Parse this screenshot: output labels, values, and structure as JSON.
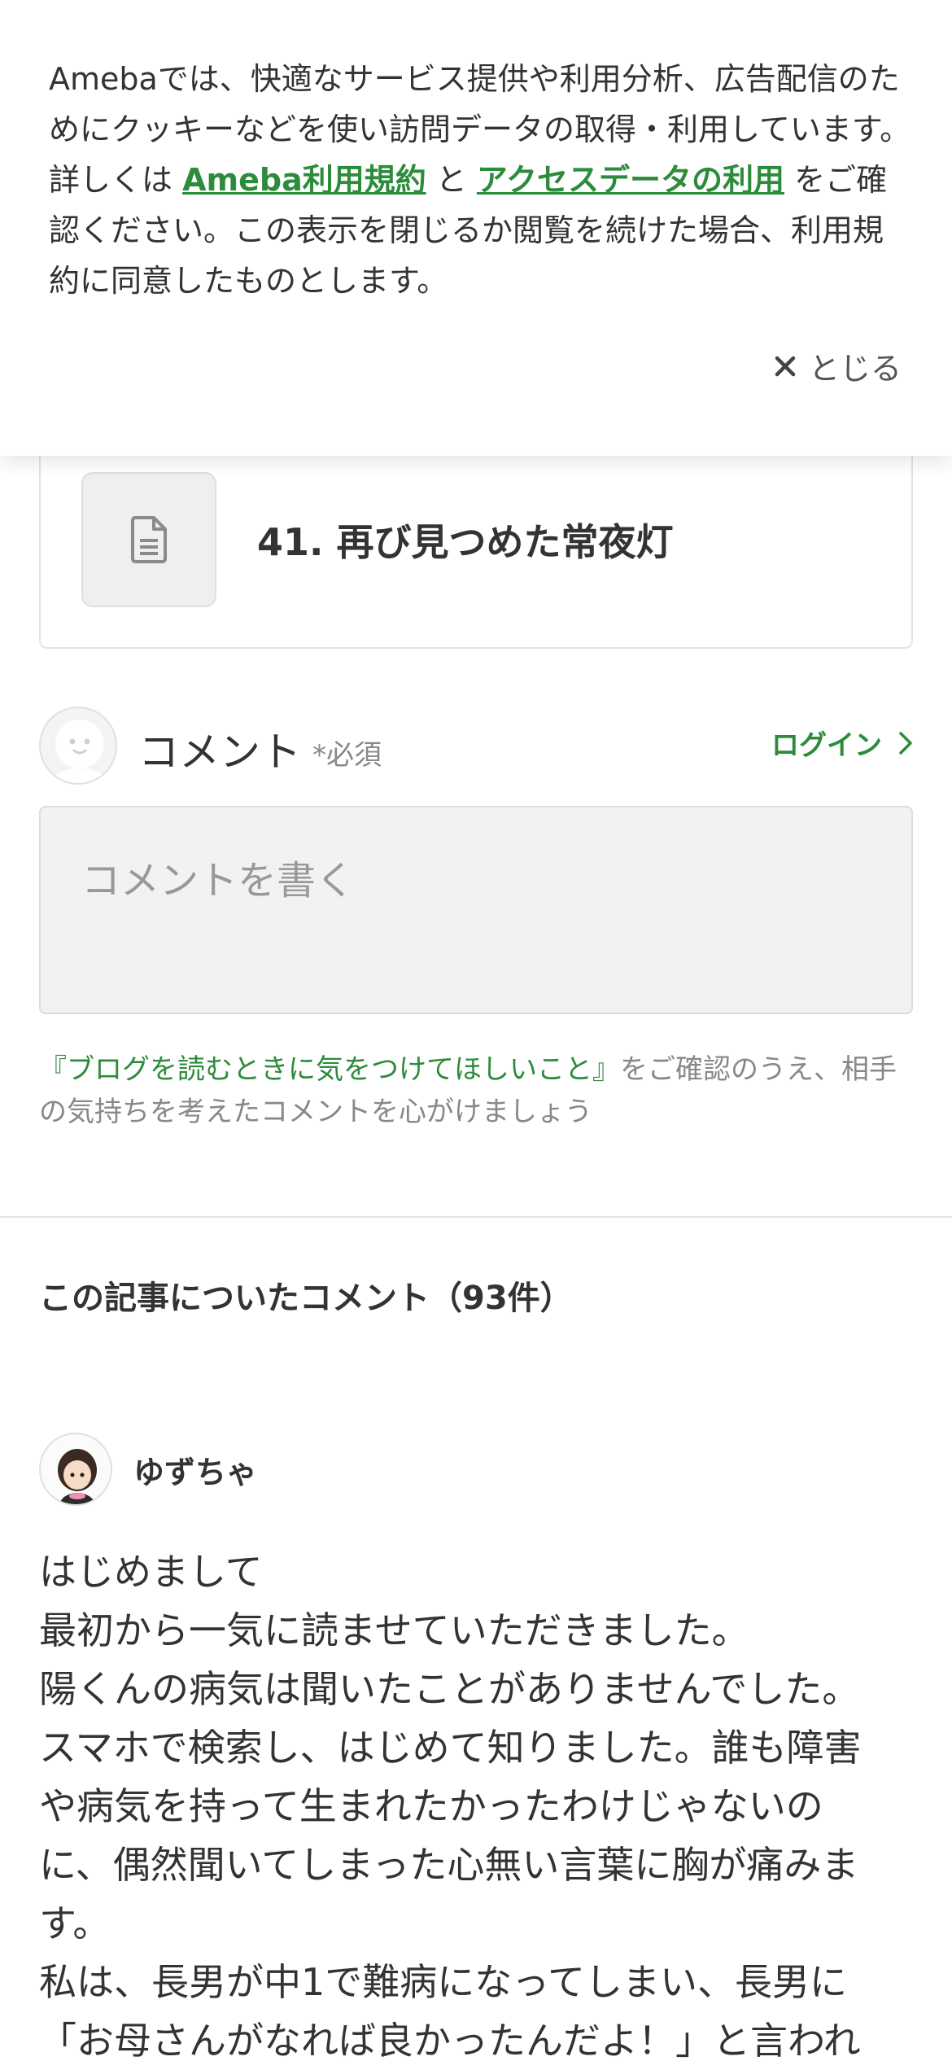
{
  "cookie_banner": {
    "text_1": "Amebaでは、快適なサービス提供や利用分析、広告配信のためにクッキーなどを使い訪問データの取得・利用しています。詳しくは ",
    "link_terms": "Ameba利用規約",
    "text_2": " と ",
    "link_access_data": "アクセスデータの利用",
    "text_3": " をご確認ください。この表示を閉じるか閲覧を続けた場合、利用規約に同意したものとします。",
    "close_label": "とじる",
    "close_icon": "close-icon"
  },
  "article": {
    "title": "41. 再び見つめた常夜灯",
    "thumb_icon": "document-icon"
  },
  "comment_form": {
    "label": "コメント",
    "required": "*必須",
    "login_label": "ログイン",
    "placeholder": "コメントを書く",
    "guideline_link": "『ブログを読むときに気をつけてほしいこと』",
    "guideline_text": "をご確認のうえ、相手の気持ちを考えたコメントを心がけましょう"
  },
  "comments": {
    "heading": "この記事についたコメント（93件）",
    "items": [
      {
        "author": "ゆずちゃ",
        "lines": [
          "はじめまして",
          "最初から一気に読ませていただきました。",
          "陽くんの病気は聞いたことがありませんでした。",
          "スマホで検索し、はじめて知りました。誰も障害",
          "や病気を持って生まれたかったわけじゃないの",
          "に、偶然聞いてしまった心無い言葉に胸が痛みま",
          "す。",
          "私は、長男が中1で難病になってしまい、長男に",
          "「お母さんがなれば良かったんだよ！」と言われ"
        ]
      }
    ]
  },
  "colors": {
    "accent_green": "#2d8c3c",
    "text": "#333333",
    "muted": "#888888"
  }
}
